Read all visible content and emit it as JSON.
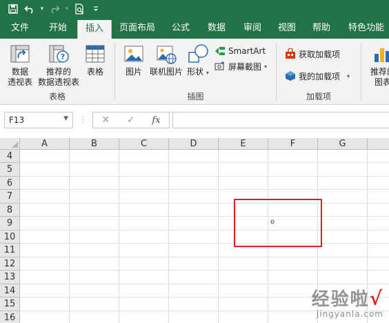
{
  "quick_access": {
    "save_icon": "save-icon",
    "undo_icon": "undo-icon",
    "redo_icon": "redo-icon",
    "preview_icon": "print-preview-icon",
    "customize_icon": "customize-qat-icon"
  },
  "tabs": [
    {
      "label": "文件"
    },
    {
      "label": "开始"
    },
    {
      "label": "插入"
    },
    {
      "label": "页面布局"
    },
    {
      "label": "公式"
    },
    {
      "label": "数据"
    },
    {
      "label": "审阅"
    },
    {
      "label": "视图"
    },
    {
      "label": "帮助"
    },
    {
      "label": "特色功能"
    }
  ],
  "ribbon": {
    "tables_group": {
      "label": "表格",
      "pivot_line1": "数据",
      "pivot_line2": "透视表",
      "rec_pivot_line1": "推荐的",
      "rec_pivot_line2": "数据透视表",
      "table": "表格"
    },
    "illustrations_group": {
      "label": "插图",
      "picture": "图片",
      "online_picture": "联机图片",
      "shapes": "形状",
      "smartart": "SmartArt",
      "screenshot": "屏幕截图"
    },
    "addins_group": {
      "label": "加载项",
      "get_addins": "获取加载项",
      "my_addins": "我的加载项"
    },
    "charts_group": {
      "rec_chart_line1": "推荐的",
      "rec_chart_line2": "图表"
    }
  },
  "formula_bar": {
    "name_box": "F13",
    "dots": "⋮",
    "cancel": "✕",
    "enter": "✓",
    "fx": "fx",
    "content": ""
  },
  "grid": {
    "columns": [
      "A",
      "B",
      "C",
      "D",
      "E",
      "F",
      "G"
    ],
    "rows": [
      "4",
      "5",
      "6",
      "7",
      "8",
      "9",
      "10",
      "11",
      "12",
      "13",
      "14",
      "15",
      "16"
    ],
    "cell_mark": "o"
  },
  "watermark": {
    "line1": "经验啦",
    "check": "√",
    "line2": "jingyanla.com"
  },
  "colors": {
    "excel_green": "#217346",
    "annotation_red": "#e02020"
  }
}
